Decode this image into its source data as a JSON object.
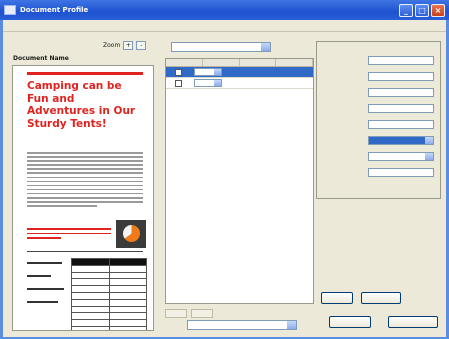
{
  "window": {
    "title": "Document Profile",
    "buttons": [
      "minimize",
      "maximize",
      "close"
    ]
  },
  "menu": {
    "items": [
      ""
    ]
  },
  "document": {
    "zoom_label": "Zoom",
    "zoom_in": "+",
    "zoom_out": "-",
    "name_label": "Document Name",
    "name_value": "",
    "headline": "Camping can be Fun and Adventures in Our Sturdy Tents!"
  },
  "fields": {
    "profile_label": "",
    "profile_value": "",
    "columns": [
      "",
      "",
      "",
      ""
    ],
    "rows": [
      {
        "name": "",
        "type": "",
        "selected": true
      },
      {
        "name": "",
        "type": "",
        "selected": false
      }
    ],
    "bottom_left_label": "",
    "bottom_left_button": "",
    "bottom_right_button": "",
    "name_label": ""
  },
  "documentum": {
    "title": "",
    "fields": [
      {
        "label": "",
        "value": "",
        "kind": "input"
      },
      {
        "label": "",
        "value": "",
        "kind": "input"
      },
      {
        "label": "",
        "value": "",
        "kind": "input"
      },
      {
        "label": "",
        "value": "",
        "kind": "input"
      },
      {
        "label": "",
        "value": "",
        "kind": "input"
      },
      {
        "label": "",
        "value": "",
        "kind": "select",
        "highlighted": true
      },
      {
        "label": "",
        "value": "",
        "kind": "select",
        "highlighted": false
      },
      {
        "label": "",
        "value": "",
        "kind": "input"
      }
    ]
  },
  "actions": {
    "login": "",
    "refresh": "",
    "cancel": "",
    "save_exit": ""
  },
  "colors": {
    "titlebar": "#2a5fd8",
    "accent_red": "#e0231f",
    "selection": "#3169c6",
    "window": "#ece9d8"
  }
}
